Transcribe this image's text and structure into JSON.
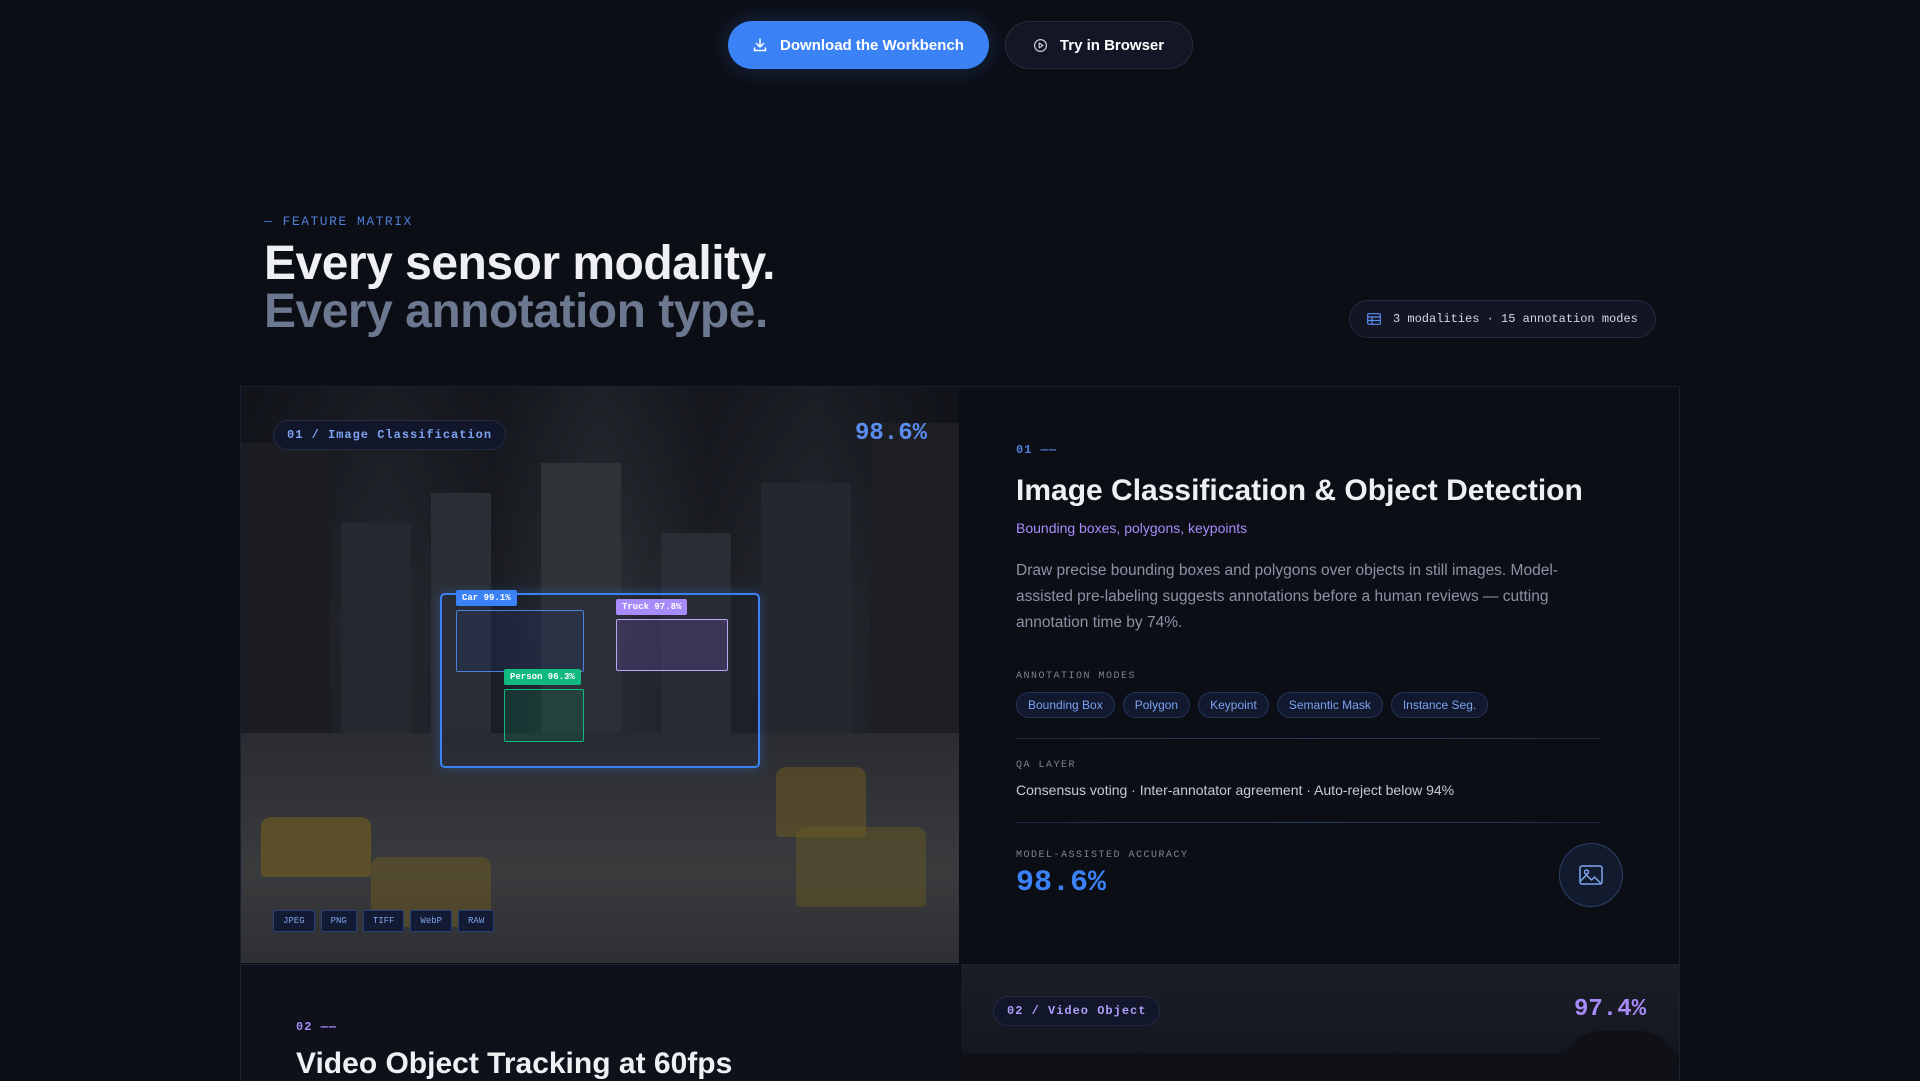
{
  "cta": {
    "download_label": "Download the Workbench",
    "try_label": "Try in Browser"
  },
  "hero": {
    "eyebrow": "— FEATURE MATRIX",
    "title_line1": "Every sensor modality.",
    "title_line2": "Every annotation type.",
    "summary": "3 modalities · 15 annotation modes"
  },
  "feature1": {
    "tag": "01 / Image Classification",
    "accuracy_badge": "98.6%",
    "detections": [
      {
        "label": "Car 99.1%",
        "color": "#3b82f6"
      },
      {
        "label": "Truck 97.8%",
        "color": "#a78bfa"
      },
      {
        "label": "Person 96.3%",
        "color": "#10b981"
      }
    ],
    "formats": [
      "JPEG",
      "PNG",
      "TIFF",
      "WebP",
      "RAW"
    ],
    "index": "01 ——",
    "title": "Image Classification & Object Detection",
    "subtitle": "Bounding boxes, polygons, keypoints",
    "description": "Draw precise bounding boxes and polygons over objects in still images. Model-assisted pre-labeling suggests annotations before a human reviews — cutting annotation time by 74%.",
    "modes_label": "ANNOTATION MODES",
    "modes": [
      "Bounding Box",
      "Polygon",
      "Keypoint",
      "Semantic Mask",
      "Instance Seg."
    ],
    "qa_label": "QA LAYER",
    "qa_text": "Consensus voting · Inter-annotator agreement · Auto-reject below 94%",
    "accuracy_label": "MODEL-ASSISTED ACCURACY",
    "accuracy_value": "98.6%"
  },
  "feature2": {
    "index": "02 ——",
    "title": "Video Object Tracking at 60fps",
    "tag": "02 / Video Object",
    "accuracy_badge": "97.4%"
  },
  "colors": {
    "accent_blue": "#3b82f6",
    "accent_purple": "#a78bfa",
    "accent_green": "#10b981",
    "background": "#0c0e15"
  },
  "icons": {
    "download": "download-icon",
    "play": "play-circle-icon",
    "table": "table-icon",
    "image": "image-icon"
  }
}
